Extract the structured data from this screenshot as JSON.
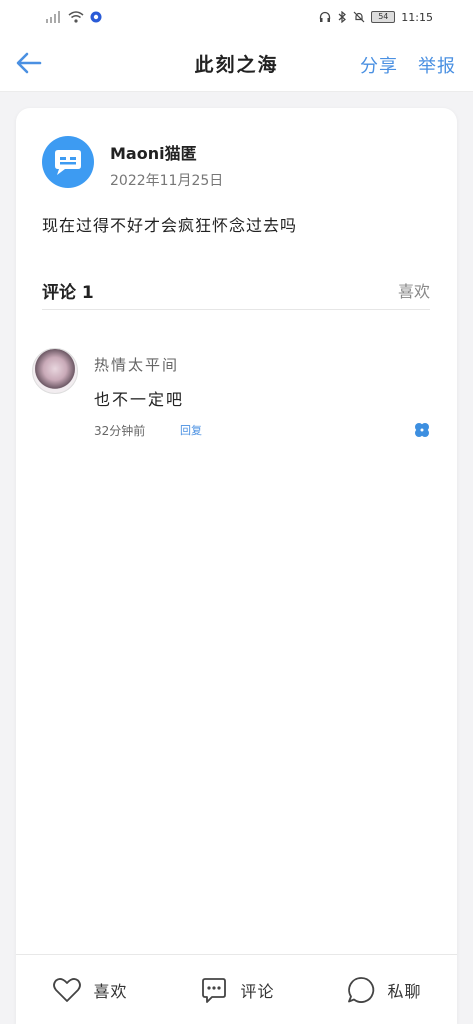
{
  "status_bar": {
    "battery": "54",
    "time": "11:15"
  },
  "nav": {
    "title": "此刻之海",
    "share_label": "分享",
    "report_label": "举报"
  },
  "post": {
    "username": "Maoni猫匿",
    "date": "2022年11月25日",
    "content": "现在过得不好才会疯狂怀念过去吗"
  },
  "comments_section": {
    "title": "评论 1",
    "like_tab": "喜欢"
  },
  "comments": [
    {
      "name": "热情太平间",
      "text": "也不一定吧",
      "time": "32分钟前",
      "reply_label": "回复"
    }
  ],
  "bottom_bar": {
    "like_label": "喜欢",
    "comment_label": "评论",
    "message_label": "私聊"
  },
  "colors": {
    "accent": "#4a90e2",
    "avatar_blue": "#3d9bf2"
  }
}
